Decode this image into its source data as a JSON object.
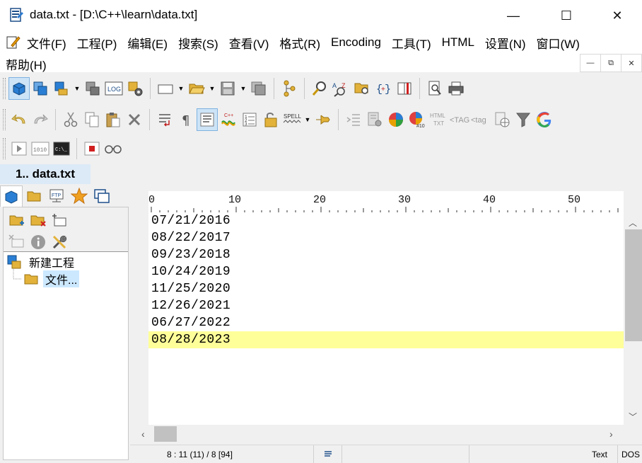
{
  "window": {
    "title": "data.txt - [D:\\C++\\learn\\data.txt]",
    "controls": {
      "minimize": "—",
      "maximize": "☐",
      "close": "✕"
    }
  },
  "menu": {
    "items": [
      "文件(F)",
      "工程(P)",
      "编辑(E)",
      "搜索(S)",
      "查看(V)",
      "格式(R)",
      "Encoding",
      "工具(T)",
      "HTML",
      "设置(N)",
      "窗口(W)"
    ],
    "help": "帮助(H)",
    "mdi": {
      "minimize": "—",
      "restore": "⧉",
      "close": "✕"
    }
  },
  "document_tab": {
    "label": "1.. data.txt"
  },
  "sidebar": {
    "tree": {
      "project": "新建工程",
      "folder": "文件..."
    }
  },
  "ruler": {
    "labels": [
      "0",
      "10",
      "20",
      "30",
      "40",
      "50"
    ]
  },
  "editor": {
    "lines": [
      "07/21/2016",
      "08/22/2017",
      "09/23/2018",
      "10/24/2019",
      "11/25/2020",
      "12/26/2021",
      "06/27/2022",
      "08/28/2023"
    ],
    "current_line_index": 7,
    "highlight_color": "#ffff99"
  },
  "statusbar": {
    "position": "8 : 11 (11) / 8  [94]",
    "mode": "Text",
    "line_ending": "DOS"
  },
  "colors": {
    "accent": "#1e6fb8",
    "folder": "#d4a017",
    "selection": "#cce8ff"
  }
}
